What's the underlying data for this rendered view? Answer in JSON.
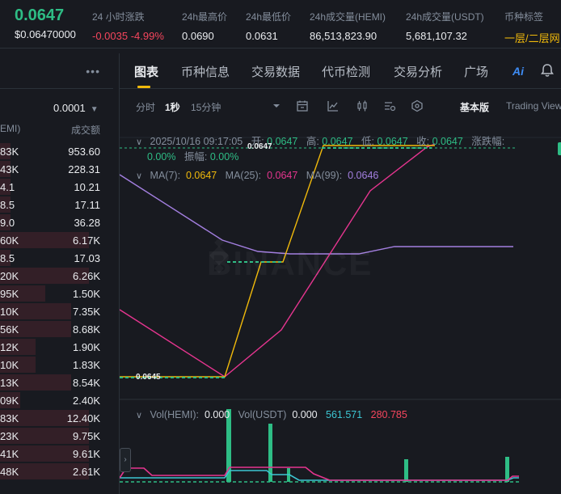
{
  "ticker": {
    "price": "0.0647",
    "price_usd": "$0.06470000",
    "stats": [
      {
        "label": "24 小时涨跌",
        "value": "-0.0035 -4.99%",
        "kind": "neg"
      },
      {
        "label": "24h最高价",
        "value": "0.0690",
        "kind": ""
      },
      {
        "label": "24h最低价",
        "value": "0.0631",
        "kind": ""
      },
      {
        "label": "24h成交量(HEMI)",
        "value": "86,513,823.90",
        "kind": ""
      },
      {
        "label": "24h成交量(USDT)",
        "value": "5,681,107.32",
        "kind": ""
      },
      {
        "label": "币种标签",
        "value": "一层/二层网",
        "kind": "tag"
      }
    ]
  },
  "orderbook": {
    "more_icon": "more-dots-icon",
    "precision": "0.0001",
    "col_left": "EMI)",
    "col_right": "成交额",
    "rows": [
      {
        "amount": "83K",
        "total": "953.60",
        "depth": 0.1
      },
      {
        "amount": "43K",
        "total": "228.31",
        "depth": 0.1
      },
      {
        "amount": "4.1",
        "total": "10.21",
        "depth": 0.1
      },
      {
        "amount": "8.5",
        "total": "17.11",
        "depth": 0.1
      },
      {
        "amount": "9.0",
        "total": "36.28",
        "depth": 0.1
      },
      {
        "amount": "60K",
        "total": "6.17K",
        "depth": 0.88
      },
      {
        "amount": "8.5",
        "total": "17.03",
        "depth": 0.1
      },
      {
        "amount": "20K",
        "total": "6.26K",
        "depth": 0.88
      },
      {
        "amount": "95K",
        "total": "1.50K",
        "depth": 0.45
      },
      {
        "amount": "10K",
        "total": "7.35K",
        "depth": 0.7
      },
      {
        "amount": "56K",
        "total": "8.68K",
        "depth": 0.7
      },
      {
        "amount": "12K",
        "total": "1.90K",
        "depth": 0.35
      },
      {
        "amount": "10K",
        "total": "1.83K",
        "depth": 0.35
      },
      {
        "amount": "13K",
        "total": "8.54K",
        "depth": 0.7
      },
      {
        "amount": "09K",
        "total": "2.40K",
        "depth": 0.2
      },
      {
        "amount": "83K",
        "total": "12.40K",
        "depth": 0.88
      },
      {
        "amount": "23K",
        "total": "9.75K",
        "depth": 0.88
      },
      {
        "amount": "41K",
        "total": "9.61K",
        "depth": 0.88
      },
      {
        "amount": "48K",
        "total": "2.61K",
        "depth": 0.88
      }
    ]
  },
  "tabs": [
    "图表",
    "币种信息",
    "交易数据",
    "代币检测",
    "交易分析",
    "广场"
  ],
  "ai_label": "Ai",
  "toolbar": {
    "time_items": [
      "分时",
      "1秒",
      "15分钟"
    ],
    "active_index": 1,
    "basic": "基本版",
    "tradingview": "Trading View"
  },
  "chart_info": {
    "datetime": "2025/10/16 09:17:05",
    "open_label": "开:",
    "open": "0.0647",
    "high_label": "高:",
    "high": "0.0647",
    "low_label": "低:",
    "low": "0.0647",
    "close_label": "收:",
    "close": "0.0647",
    "change_label": "涨跌幅:",
    "change": "0.00%",
    "amp_label": "振幅:",
    "amp": "0.00%",
    "ma7_label": "MA(7):",
    "ma7": "0.0647",
    "ma25_label": "MA(25):",
    "ma25": "0.0647",
    "ma99_label": "MA(99):",
    "ma99": "0.0646",
    "vol_hemi_label": "Vol(HEMI):",
    "vol_hemi": "0.000",
    "vol_usdt_label": "Vol(USDT)",
    "vol_usdt": "0.000",
    "vol_ma1": "561.571",
    "vol_ma2": "280.785",
    "tag_high": "0.0647",
    "tag_low": "0.0645",
    "watermark": "BINANCE"
  },
  "colors": {
    "up": "#2ebd85",
    "down": "#f6465d",
    "ma7": "#f0b90b",
    "ma25": "#e5358f",
    "ma99": "#a37fe0",
    "vol_ma1": "#3cc6d3"
  }
}
